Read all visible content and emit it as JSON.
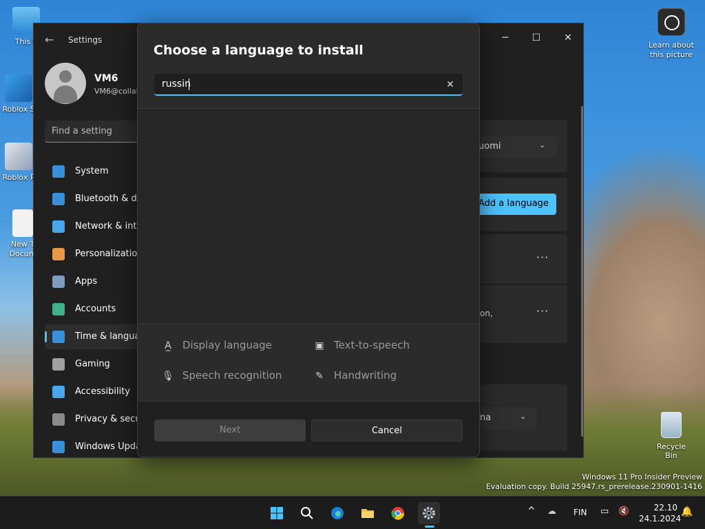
{
  "desktop": {
    "icons": [
      {
        "label": "This P"
      },
      {
        "label": "Roblox S"
      },
      {
        "label": "Roblox P"
      },
      {
        "label": "New T Docum"
      }
    ],
    "learn_about": "Learn about this picture",
    "recycle_bin": "Recycle Bin",
    "watermark_line1": "Windows 11 Pro Insider Preview",
    "watermark_line2": "Evaluation copy. Build 25947.rs_prerelease.230901-1416"
  },
  "settings": {
    "title": "Settings",
    "window_controls": {
      "minimize": "─",
      "maximize": "☐",
      "close": "✕"
    },
    "profile": {
      "name": "VM6",
      "email": "VM6@collal"
    },
    "search_placeholder": "Find a setting",
    "nav": [
      {
        "label": "System",
        "color": "#3b8fd9"
      },
      {
        "label": "Bluetooth & de",
        "color": "#3b8fd9"
      },
      {
        "label": "Network & inte",
        "color": "#4aa8e8"
      },
      {
        "label": "Personalization",
        "color": "#e59a4a"
      },
      {
        "label": "Apps",
        "color": "#7f9cc0"
      },
      {
        "label": "Accounts",
        "color": "#3fb28a"
      },
      {
        "label": "Time & langua",
        "color": "#3b8fd9"
      },
      {
        "label": "Gaming",
        "color": "#a0a0a0"
      },
      {
        "label": "Accessibility",
        "color": "#4aa8e8"
      },
      {
        "label": "Privacy & secu",
        "color": "#8a8a8a"
      },
      {
        "label": "Windows Upda",
        "color": "#3b8fd9"
      }
    ],
    "content": {
      "region_dropdown": "uomi",
      "add_language": "Add a language",
      "card_text": "on,",
      "format_dropdown": "na",
      "more": "···"
    }
  },
  "dialog": {
    "title": "Choose a language to install",
    "search_value": "russin",
    "clear": "✕",
    "features": {
      "display_language": "Display language",
      "text_to_speech": "Text-to-speech",
      "speech_recognition": "Speech recognition",
      "handwriting": "Handwriting"
    },
    "next": "Next",
    "cancel": "Cancel"
  },
  "taskbar": {
    "language": "FIN",
    "time": "22.10",
    "date": "24.1.2024",
    "chevron": "^"
  },
  "colors": {
    "accent": "#4cc2ff",
    "dialog_bg": "#2b2b2b",
    "window_bg": "#202020"
  }
}
